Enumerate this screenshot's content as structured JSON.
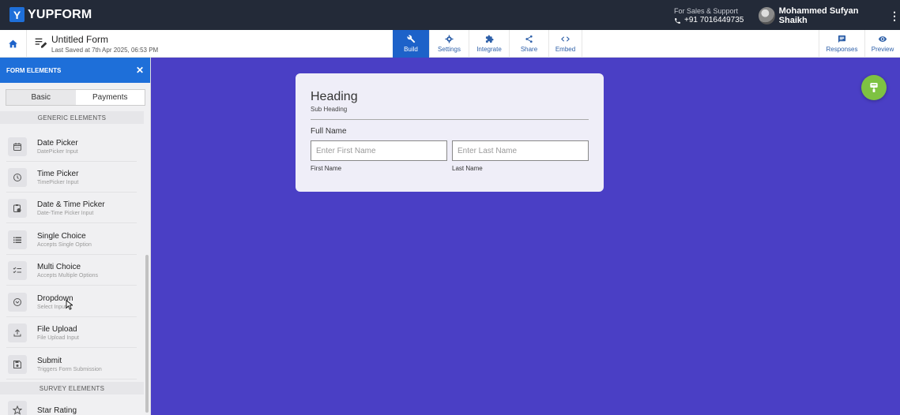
{
  "brand": {
    "name": "YUPFORM",
    "logo_letter": "Y"
  },
  "support": {
    "label": "For Sales & Support",
    "phone": "+91 7016449735"
  },
  "user": {
    "name": "Mohammed Sufyan Shaikh"
  },
  "form": {
    "title": "Untitled Form",
    "saved": "Last Saved at 7th Apr 2025, 06:53 PM"
  },
  "tabs": [
    {
      "label": "Build",
      "icon": "wrench-icon",
      "active": true
    },
    {
      "label": "Settings",
      "icon": "gear-icon"
    },
    {
      "label": "Integrate",
      "icon": "puzzle-icon"
    },
    {
      "label": "Share",
      "icon": "share-icon"
    },
    {
      "label": "Embed",
      "icon": "code-icon"
    }
  ],
  "right_tabs": [
    {
      "label": "Responses",
      "icon": "message-icon"
    },
    {
      "label": "Preview",
      "icon": "eye-icon"
    }
  ],
  "sidebar": {
    "title": "FORM ELEMENTS",
    "segments": [
      "Basic",
      "Payments"
    ],
    "generic_label": "GENERIC ELEMENTS",
    "survey_label": "SURVEY ELEMENTS",
    "items": [
      {
        "name": "Date Picker",
        "sub": "DatePicker Input",
        "icon": "calendar-icon"
      },
      {
        "name": "Time Picker",
        "sub": "TimePicker Input",
        "icon": "clock-icon"
      },
      {
        "name": "Date & Time Picker",
        "sub": "Date-Time Picker Input",
        "icon": "calendar-clock-icon"
      },
      {
        "name": "Single Choice",
        "sub": "Accepts Single Option",
        "icon": "list-icon"
      },
      {
        "name": "Multi Choice",
        "sub": "Accepts Multiple Options",
        "icon": "checklist-icon"
      },
      {
        "name": "Dropdown",
        "sub": "Select Input",
        "icon": "chevron-circle-icon"
      },
      {
        "name": "File Upload",
        "sub": "File Upload Input",
        "icon": "upload-icon"
      },
      {
        "name": "Submit",
        "sub": "Triggers Form Submission",
        "icon": "save-icon"
      }
    ],
    "survey_items": [
      {
        "name": "Star Rating",
        "icon": "star-icon"
      }
    ]
  },
  "card": {
    "heading": "Heading",
    "subheading": "Sub Heading",
    "field_label": "Full Name",
    "first_placeholder": "Enter First Name",
    "last_placeholder": "Enter Last Name",
    "first_caption": "First Name",
    "last_caption": "Last Name"
  },
  "colors": {
    "canvas": "#4a3fc5",
    "accent": "#1e6fd9",
    "topbar": "#232a38",
    "fab": "#7ec242"
  }
}
